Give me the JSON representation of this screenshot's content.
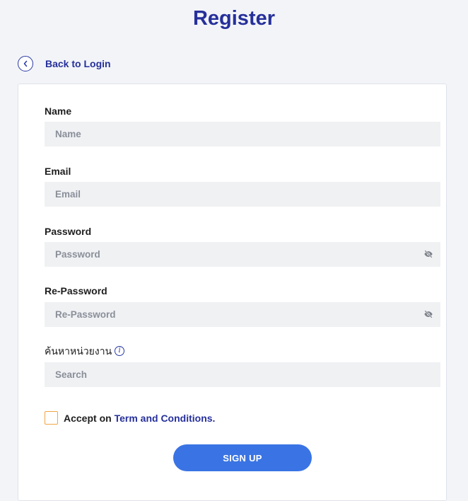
{
  "page": {
    "title": "Register"
  },
  "back": {
    "label": "Back to Login",
    "icon": "chevron-left-icon"
  },
  "form": {
    "name": {
      "label": "Name",
      "placeholder": "Name"
    },
    "email": {
      "label": "Email",
      "placeholder": "Email"
    },
    "password": {
      "label": "Password",
      "placeholder": "Password",
      "icon": "eye-off-icon"
    },
    "repassword": {
      "label": "Re-Password",
      "placeholder": "Re-Password",
      "icon": "eye-off-icon"
    },
    "department": {
      "label": "ค้นหาหน่วยงาน",
      "placeholder": "Search",
      "icon": "info-icon"
    },
    "terms": {
      "prefix": "Accept on",
      "link": "Term and Conditions.",
      "checked": false
    },
    "submit": {
      "label": "SIGN UP"
    }
  },
  "colors": {
    "brand": "#26309a",
    "button": "#3a74e4",
    "checkbox_border": "#f0a645",
    "input_bg": "#f0f1f3"
  }
}
